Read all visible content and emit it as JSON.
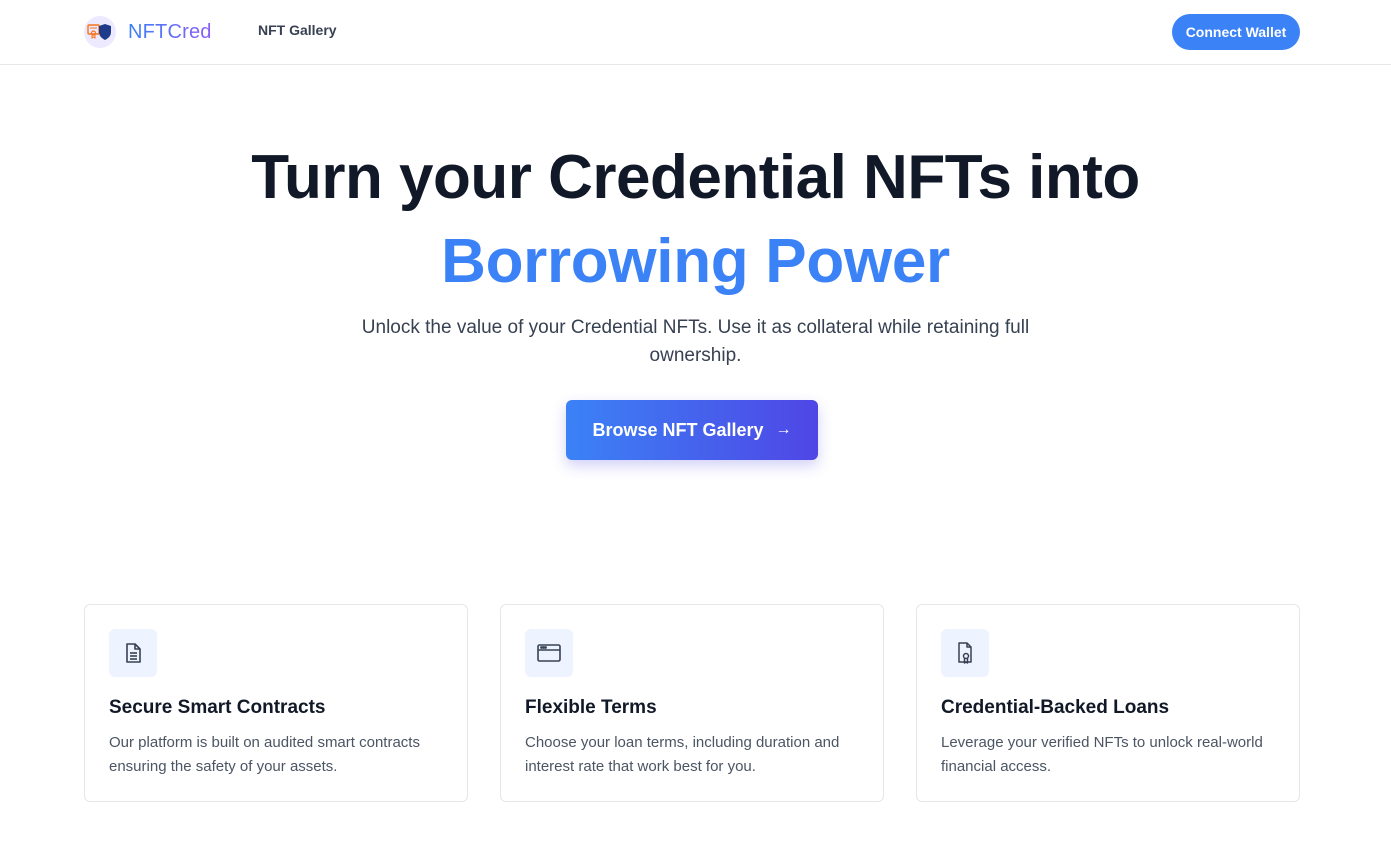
{
  "header": {
    "brand_name": "NFTCred",
    "nav_items": [
      {
        "label": "NFT Gallery"
      }
    ],
    "connect_label": "Connect Wallet"
  },
  "hero": {
    "title_line1": "Turn your Credential NFTs into",
    "title_line2": "Borrowing Power",
    "subtitle": "Unlock the value of your Credential NFTs. Use it as collateral while retaining full ownership.",
    "cta_label": "Browse NFT Gallery",
    "cta_icon": "arrow-right-icon"
  },
  "features": [
    {
      "icon": "document-icon",
      "title": "Secure Smart Contracts",
      "description": "Our platform is built on audited smart contracts ensuring the safety of your assets."
    },
    {
      "icon": "browser-window-icon",
      "title": "Flexible Terms",
      "description": "Choose your loan terms, including duration and interest rate that work best for you."
    },
    {
      "icon": "certificate-document-icon",
      "title": "Credential-Backed Loans",
      "description": "Leverage your verified NFTs to unlock real-world financial access."
    }
  ],
  "colors": {
    "accent": "#3b82f6",
    "accent_secondary": "#4f46e5",
    "heading": "#111827",
    "body_text": "#374151"
  }
}
